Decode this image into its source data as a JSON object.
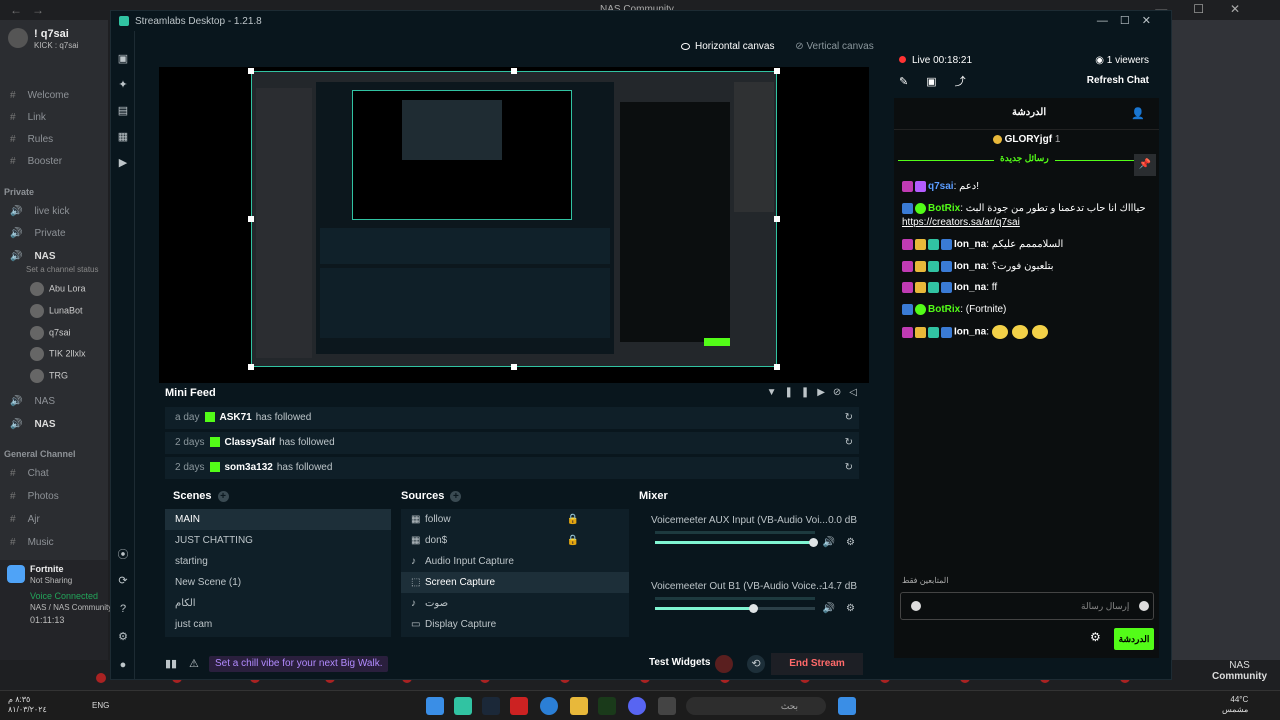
{
  "discord": {
    "server_title": "NAS Community",
    "user": {
      "name": "! q7sai",
      "status": "KICK : q7sai"
    },
    "channels": [
      {
        "label": "Welcome"
      },
      {
        "label": "Link"
      },
      {
        "label": "Rules"
      },
      {
        "label": "Booster"
      }
    ],
    "category_private": "Private",
    "private_channels": [
      {
        "label": "live kick"
      },
      {
        "label": "Private"
      },
      {
        "label": "NAS"
      }
    ],
    "set_status": "Set a channel status",
    "members": [
      "Abu Lora",
      "LunaBot",
      "q7sai",
      "TIK 2llxlx",
      "TRG"
    ],
    "voice_channels": [
      "NAS",
      "NAS"
    ],
    "category_general": "General Channel",
    "general_channels": [
      {
        "label": "Chat"
      },
      {
        "label": "Photos"
      },
      {
        "label": "Ajr"
      },
      {
        "label": "Music"
      }
    ],
    "activity": {
      "game": "Fortnite",
      "state": "Not Sharing"
    },
    "voice": {
      "status": "Voice Connected",
      "channel": "NAS / NAS Community",
      "timer": "01:11:13"
    },
    "right_label_1": "NAS",
    "right_label_2": "Community"
  },
  "taskbar": {
    "time": "٨:٣٥ م",
    "date": "٨١/٠٣/٢٠٢٤",
    "lang": "ENG",
    "search_placeholder": "بحث",
    "weather_temp": "44°C",
    "weather_state": "مشمس"
  },
  "streamlabs": {
    "title": "Streamlabs Desktop - 1.21.8",
    "canvas_tabs": {
      "horizontal": "Horizontal canvas",
      "vertical": "Vertical canvas"
    },
    "minifeed": {
      "title": "Mini Feed",
      "rows": [
        {
          "when": "a day",
          "user": "ASK71",
          "action": "has followed"
        },
        {
          "when": "2 days",
          "user": "ClassySaif",
          "action": "has followed"
        },
        {
          "when": "2 days",
          "user": "som3a132",
          "action": "has followed"
        }
      ]
    },
    "scenes": {
      "title": "Scenes",
      "items": [
        "MAIN",
        "JUST CHATTING",
        "starting",
        "New Scene (1)",
        "الكام",
        "just cam"
      ],
      "selected": "MAIN"
    },
    "sources": {
      "title": "Sources",
      "items": [
        "follow",
        "don$",
        "Audio Input Capture",
        "Screen Capture",
        "صوت",
        "Display Capture"
      ],
      "selected": "Screen Capture"
    },
    "mixer": {
      "title": "Mixer",
      "channels": [
        {
          "name": "Voicemeeter AUX Input (VB-Audio Voi...",
          "db": "0.0 dB",
          "volume": 1.0
        },
        {
          "name": "Voicemeeter Out B1 (VB-Audio Voice...",
          "db": "-14.7 dB",
          "volume": 0.62
        }
      ]
    },
    "footer": {
      "tip": "Set a chill vibe for your next Big Walk.",
      "test_widgets": "Test Widgets",
      "end_stream": "End Stream"
    },
    "live": {
      "status": "Live 00:18:21",
      "viewers": "1 viewers",
      "refresh": "Refresh Chat"
    }
  },
  "chat": {
    "tab_title": "الدردشة",
    "pinned_user": "GLORYjgf",
    "pinned_count": "1",
    "new_messages": "رسائل جديدة",
    "messages": [
      {
        "user": "q7sai",
        "text": "دعم!",
        "color": "#5b9cff"
      },
      {
        "user": "BotRix",
        "text": "حياااك انا حاب تدعمنا و تطور من جودة البث",
        "color": "#53fc18"
      },
      {
        "user": "",
        "text": "https://creators.sa/ar/q7sai",
        "color": "#ffffff"
      },
      {
        "user": "Ion_na",
        "text": "السلامممم عليكم",
        "color": "#ffffff"
      },
      {
        "user": "Ion_na",
        "text": "بتلعبون فورت؟",
        "color": "#ffffff"
      },
      {
        "user": "Ion_na",
        "text": "ff",
        "color": "#ffffff"
      },
      {
        "user": "BotRix",
        "text": "(Fortnite)",
        "color": "#53fc18"
      },
      {
        "user": "Ion_na",
        "text": "",
        "color": "#ffffff"
      }
    ],
    "followers_only": "المتابعين فقط",
    "input_placeholder": "إرسال رسالة",
    "send_label": "الدردشة"
  }
}
